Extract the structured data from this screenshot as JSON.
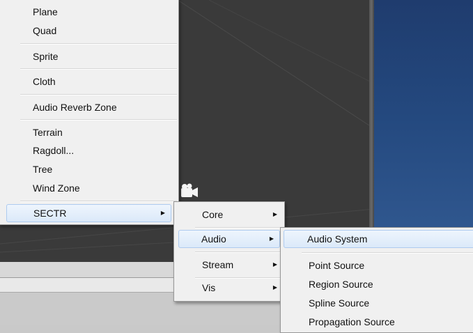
{
  "scene": {
    "dark_color": "#3a3a3a",
    "blue_color": "#24497f",
    "icon": "camera-gizmo-icon"
  },
  "main_menu": {
    "items": [
      {
        "label": "Plane"
      },
      {
        "label": "Quad"
      },
      {
        "label": "Sprite"
      },
      {
        "label": "Cloth"
      },
      {
        "label": "Audio Reverb Zone"
      },
      {
        "label": "Terrain"
      },
      {
        "label": "Ragdoll..."
      },
      {
        "label": "Tree"
      },
      {
        "label": "Wind Zone"
      },
      {
        "label": "SECTR",
        "submenu": true,
        "highlighted": true
      }
    ]
  },
  "sectr_menu": {
    "items": [
      {
        "label": "Core",
        "submenu": true
      },
      {
        "label": "Audio",
        "submenu": true,
        "highlighted": true
      },
      {
        "label": "Stream",
        "submenu": true
      },
      {
        "label": "Vis",
        "submenu": true
      }
    ]
  },
  "audio_menu": {
    "items": [
      {
        "label": "Audio System",
        "highlighted": true
      },
      {
        "label": "Point Source"
      },
      {
        "label": "Region Source"
      },
      {
        "label": "Spline Source"
      },
      {
        "label": "Propagation Source"
      }
    ]
  },
  "colors": {
    "menu_bg": "#f0f0f0",
    "highlight": "#dbe9f9",
    "highlight_border": "#aecbef"
  }
}
